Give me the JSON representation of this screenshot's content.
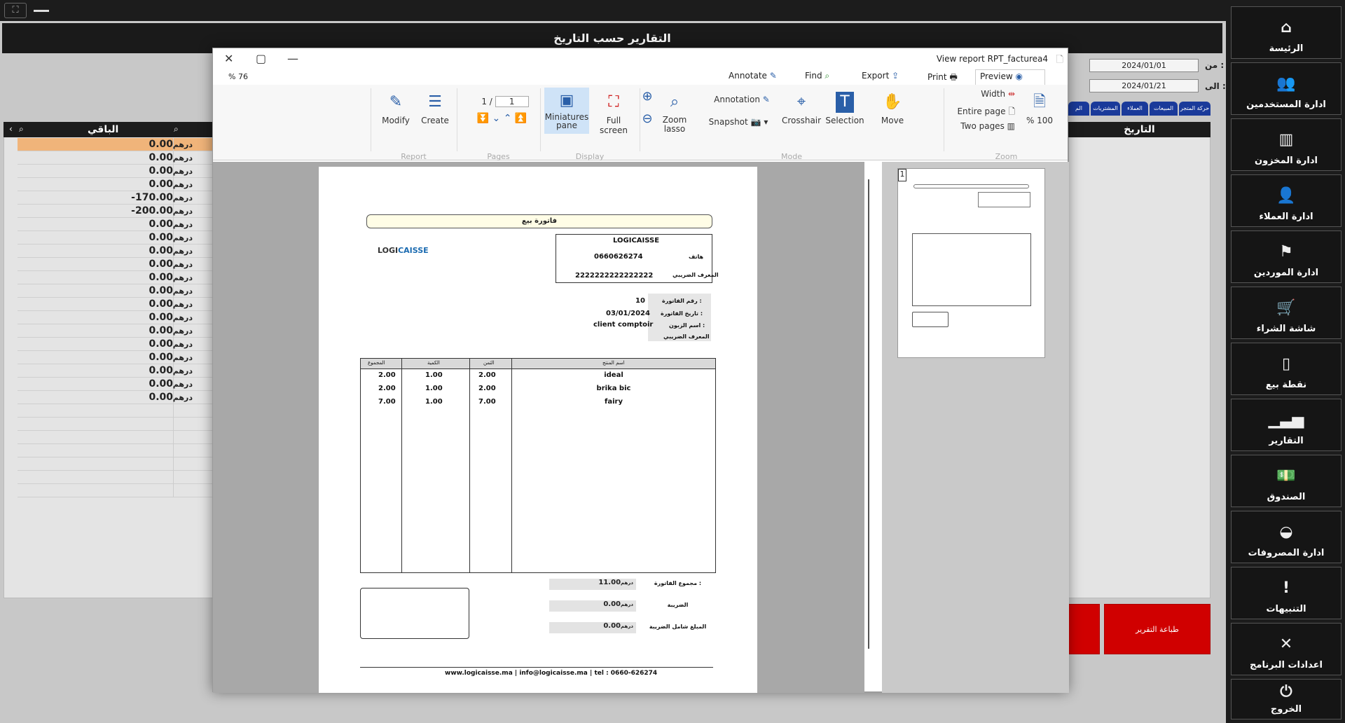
{
  "window": {
    "title": "التقارير حسب التاريخ"
  },
  "sidebar": {
    "items": [
      {
        "label": "الرئيسة",
        "icon": "home-icon"
      },
      {
        "label": "ادارة المستخدمين",
        "icon": "users-icon"
      },
      {
        "label": "ادارة المخزون",
        "icon": "inventory-icon"
      },
      {
        "label": "ادارة العملاء",
        "icon": "customer-icon"
      },
      {
        "label": "ادارة الموردين",
        "icon": "supplier-icon"
      },
      {
        "label": "شاشة الشراء",
        "icon": "cart-icon"
      },
      {
        "label": "نقطة بيع",
        "icon": "pos-icon"
      },
      {
        "label": "التقارير",
        "icon": "report-icon"
      },
      {
        "label": "الصندوق",
        "icon": "cash-icon"
      },
      {
        "label": "ادارة المصروفات",
        "icon": "expenses-icon"
      },
      {
        "label": "التنبيهات",
        "icon": "alert-icon"
      },
      {
        "label": "اعدادات البرنامج",
        "icon": "settings-icon"
      },
      {
        "label": "الخروج",
        "icon": "power-icon"
      }
    ]
  },
  "filters": {
    "from_label": "من :",
    "to_label": "الى :",
    "from_date": "2024/01/01",
    "to_date": "2024/01/21"
  },
  "tabs": [
    "حركة المتجر",
    "المبيعات",
    "العملاء",
    "المشتريات",
    "الم"
  ],
  "right_table": {
    "header": "التاريخ"
  },
  "left_table": {
    "header": "الباقي",
    "currency": "درهم",
    "values": [
      "0.00",
      "0.00",
      "0.00",
      "0.00",
      "-170.00",
      "-200.00",
      "0.00",
      "0.00",
      "0.00",
      "0.00",
      "0.00",
      "0.00",
      "0.00",
      "0.00",
      "0.00",
      "0.00",
      "0.00",
      "0.00",
      "0.00",
      "0.00"
    ]
  },
  "print_button": "طباعة التقرير",
  "dialog": {
    "title": "View report RPT_facturea4",
    "zoom_input": "% 76",
    "menu": {
      "annotate": "Annotate",
      "find": "Find",
      "export": "Export",
      "print": "Print",
      "preview": "Preview"
    },
    "ribbon": {
      "modify": "Modify",
      "create": "Create",
      "report_group": "Report",
      "page_current": "1",
      "page_total": "1 /",
      "pages_group": "Pages",
      "miniatures": "Miniatures pane",
      "fullscreen": "Full screen",
      "display_group": "Display",
      "zoom_lasso": "Zoom lasso",
      "annotation": "Annotation",
      "snapshot": "Snapshot",
      "crosshair": "Crosshair",
      "selection": "Selection",
      "move": "Move",
      "mode_group": "Mode",
      "width": "Width",
      "entire_page": "Entire page",
      "two_pages": "Two pages",
      "zoom100": "% 100",
      "zoom_group": "Zoom"
    },
    "thumb_number": "1"
  },
  "invoice": {
    "title": "فاتورة بيع",
    "logo_left": "LOGI",
    "logo_right": "CAISSE",
    "company": "LOGICAISSE",
    "phone_label": "هاتف",
    "phone": "0660626274",
    "taxid_label": "المعرف الضريبي",
    "taxid": "2222222222222222",
    "meta": [
      {
        "label": "رقم الفاتورة :",
        "value": "10"
      },
      {
        "label": "تاريخ الفاتورة :",
        "value": "03/01/2024"
      },
      {
        "label": "اسم الزبون :",
        "value": "client comptoir"
      },
      {
        "label": "المعرف الضريبي",
        "value": ""
      }
    ],
    "columns": [
      "المجموع",
      "الكمية",
      "الثمن",
      "اسم المنتج"
    ],
    "lines": [
      {
        "total": "2.00",
        "qty": "1.00",
        "price": "2.00",
        "name": "ideal"
      },
      {
        "total": "2.00",
        "qty": "1.00",
        "price": "2.00",
        "name": "brika bic"
      },
      {
        "total": "7.00",
        "qty": "1.00",
        "price": "7.00",
        "name": "fairy"
      }
    ],
    "totals": [
      {
        "label": "مجموع الفاتورة :",
        "value": "11.00",
        "unit": "درهم"
      },
      {
        "label": "الضريبة",
        "value": "0.00",
        "unit": "درهم"
      },
      {
        "label": "المبلغ شامل الضريبة",
        "value": "0.00",
        "unit": "درهم"
      }
    ],
    "footer": "www.logicaisse.ma | info@logicaisse.ma | tel : 0660-626274"
  }
}
